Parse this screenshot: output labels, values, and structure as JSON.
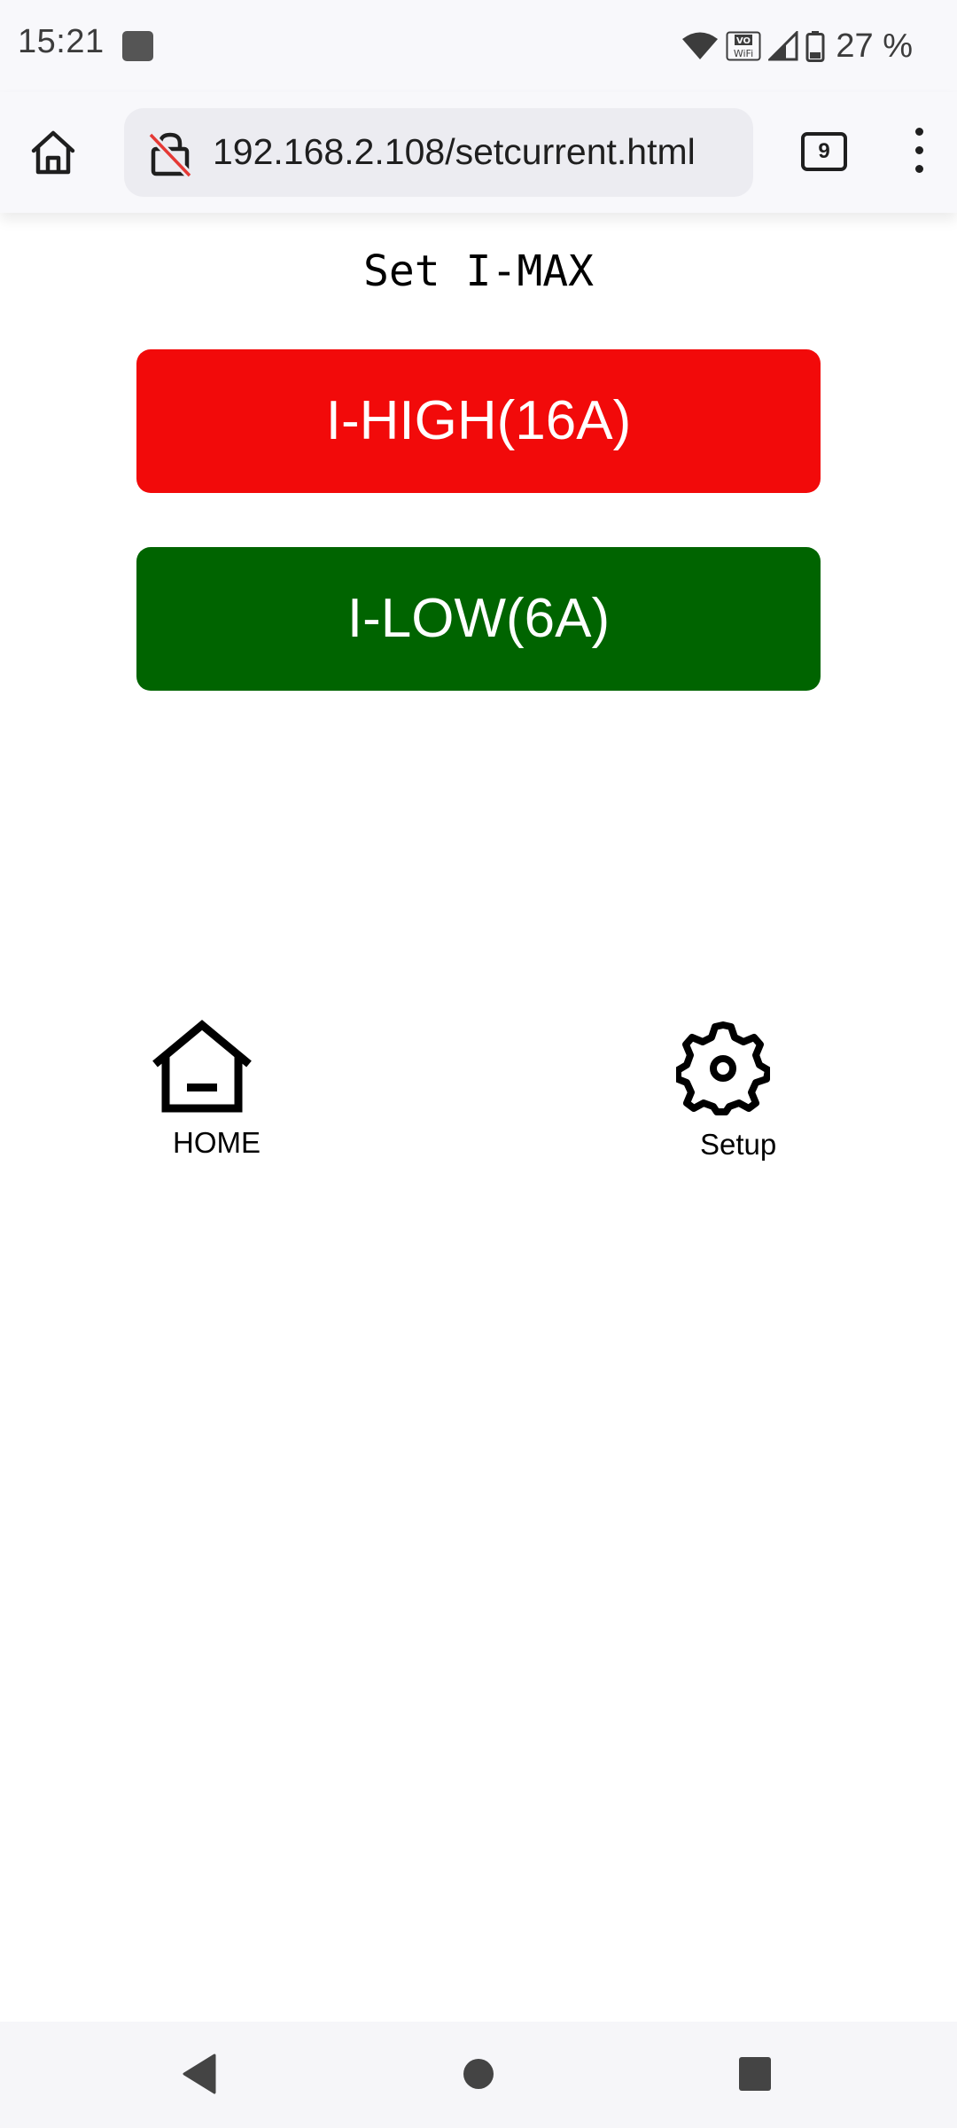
{
  "status_bar": {
    "time": "15:21",
    "battery_percent": "27 %",
    "icons": [
      "notification-icon",
      "wifi-icon",
      "vowifi-icon",
      "signal-icon",
      "battery-icon"
    ],
    "vowifi_text": "VO\nWiFi"
  },
  "browser": {
    "url": "192.168.2.108/setcurrent.html",
    "tab_count": "9",
    "icons": [
      "home-icon",
      "not-secure-lock-icon",
      "tabs-icon",
      "menu-icon"
    ]
  },
  "page": {
    "title": "Set I-MAX",
    "buttons": {
      "high": {
        "label": "I-HIGH(16A)",
        "color": "#f20a0a"
      },
      "low": {
        "label": "I-LOW(6A)",
        "color": "#006400"
      }
    },
    "nav": {
      "home_label": "HOME",
      "setup_label": "Setup"
    }
  },
  "system_nav": {
    "icons": [
      "back-icon",
      "home-circle-icon",
      "recents-icon"
    ]
  }
}
